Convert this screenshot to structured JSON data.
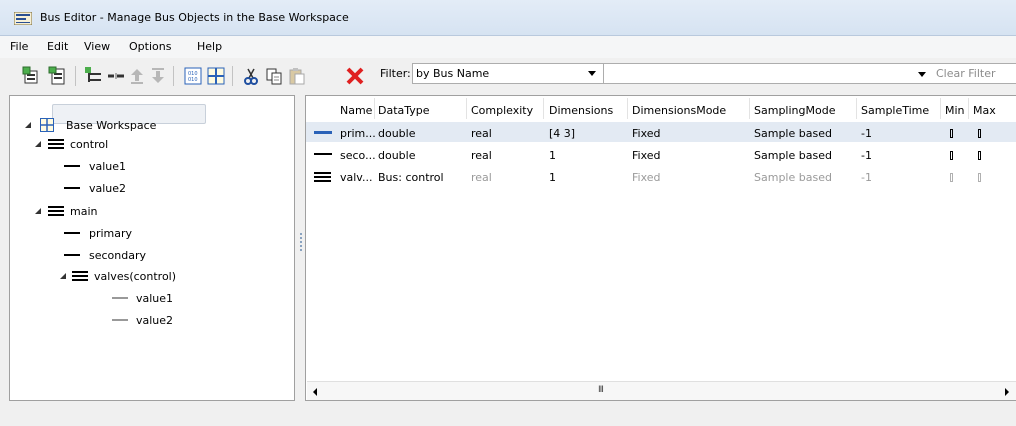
{
  "window": {
    "title": "Bus Editor - Manage Bus Objects in the Base Workspace"
  },
  "menu": [
    "File",
    "Edit",
    "View",
    "Options",
    "Help"
  ],
  "filter": {
    "label": "Filter:",
    "selected": "by Bus Name",
    "text_value": "",
    "clear_label": "Clear Filter"
  },
  "tree": {
    "root": "Base Workspace",
    "items": [
      "control",
      "value1",
      "value2",
      "main",
      "primary",
      "secondary",
      "valves(control)",
      "value1",
      "value2"
    ]
  },
  "table": {
    "columns": [
      "Name",
      "DataType",
      "Complexity",
      "Dimensions",
      "DimensionsMode",
      "SamplingMode",
      "SampleTime",
      "Min",
      "Max"
    ],
    "rows": [
      {
        "name": "prim...",
        "datatype": "double",
        "complexity": "real",
        "dimensions": "[4 3]",
        "dimensions_mode": "Fixed",
        "sampling_mode": "Sample based",
        "sample_time": "-1",
        "min": "[]",
        "max": "[]",
        "icon": "signal-icon"
      },
      {
        "name": "seco...",
        "datatype": "double",
        "complexity": "real",
        "dimensions": "1",
        "dimensions_mode": "Fixed",
        "sampling_mode": "Sample based",
        "sample_time": "-1",
        "min": "[]",
        "max": "[]",
        "icon": "signal-icon"
      },
      {
        "name": "valv...",
        "datatype": "Bus: control",
        "complexity": "real",
        "dimensions": "1",
        "dimensions_mode": "Fixed",
        "sampling_mode": "Sample based",
        "sample_time": "-1",
        "min": "[]",
        "max": "[]",
        "icon": "bus-icon"
      }
    ]
  },
  "scrollbar": {
    "grip": "III"
  },
  "colors": {
    "selection": "#e3eaf3",
    "accent_blue": "#2a62b8",
    "delete_red": "#e02020"
  }
}
